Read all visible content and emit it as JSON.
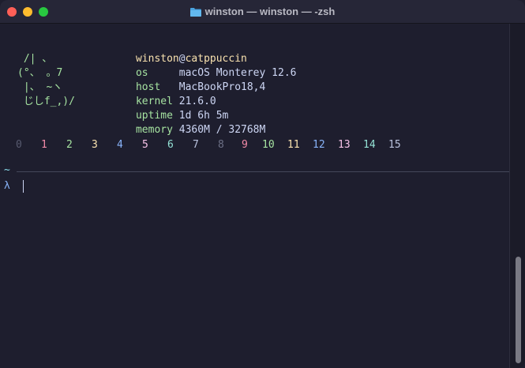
{
  "window": {
    "title": "winston — winston — -zsh",
    "icon": "folder-icon"
  },
  "ascii_art": [
    " /| 、",
    "(°、 。7",
    " |、 ~ヽ",
    " じしf_,)/"
  ],
  "neofetch": {
    "user": "winston",
    "at": "@",
    "host": "catppuccin",
    "fields": [
      {
        "key": "os",
        "pad": "     ",
        "value": "macOS Monterey 12.6"
      },
      {
        "key": "host",
        "pad": "   ",
        "value": "MacBookPro18,4"
      },
      {
        "key": "kernel",
        "pad": " ",
        "value": "21.6.0"
      },
      {
        "key": "uptime",
        "pad": " ",
        "value": "1d 6h 5m"
      },
      {
        "key": "memory",
        "pad": " ",
        "value": "4360M / 32768M"
      }
    ]
  },
  "palette": [
    {
      "label": "0",
      "color": "#585b70"
    },
    {
      "label": "1",
      "color": "#f38ba8"
    },
    {
      "label": "2",
      "color": "#a6e3a1"
    },
    {
      "label": "3",
      "color": "#f9e2af"
    },
    {
      "label": "4",
      "color": "#89b4fa"
    },
    {
      "label": "5",
      "color": "#f5c2e7"
    },
    {
      "label": "6",
      "color": "#94e2d5"
    },
    {
      "label": "7",
      "color": "#bac2de"
    },
    {
      "label": "8",
      "color": "#6c7086"
    },
    {
      "label": "9",
      "color": "#f38ba8"
    },
    {
      "label": "10",
      "color": "#a6e3a1"
    },
    {
      "label": "11",
      "color": "#f9e2af"
    },
    {
      "label": "12",
      "color": "#89b4fa"
    },
    {
      "label": "13",
      "color": "#f5c2e7"
    },
    {
      "label": "14",
      "color": "#94e2d5"
    },
    {
      "label": "15",
      "color": "#bac2de"
    }
  ],
  "prompt": {
    "dir": "~",
    "symbol": "λ"
  }
}
